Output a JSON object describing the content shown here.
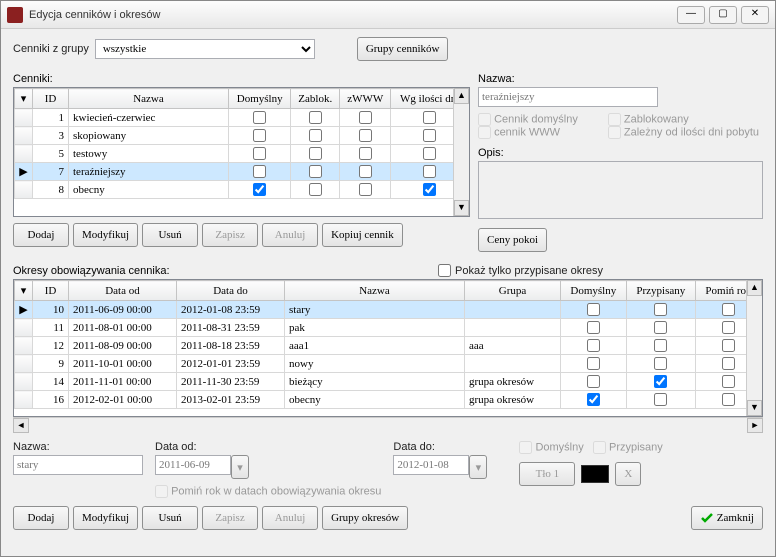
{
  "window": {
    "title": "Edycja cenników i okresów"
  },
  "topbar": {
    "group_label": "Cenniki z grupy",
    "group_selected": "wszystkie",
    "groups_btn": "Grupy cenników"
  },
  "cenniki": {
    "label": "Cenniki:",
    "columns": {
      "id": "ID",
      "nazwa": "Nazwa",
      "domyslny": "Domyślny",
      "zablok": "Zablok.",
      "zwww": "zWWW",
      "wgdni": "Wg ilości dni"
    },
    "rows": [
      {
        "id": 1,
        "nazwa": "kwiecień-czerwiec",
        "dom": false,
        "zab": false,
        "zw": false,
        "wg": false,
        "sel": false
      },
      {
        "id": 3,
        "nazwa": "skopiowany",
        "dom": false,
        "zab": false,
        "zw": false,
        "wg": false,
        "sel": false
      },
      {
        "id": 5,
        "nazwa": "testowy",
        "dom": false,
        "zab": false,
        "zw": false,
        "wg": false,
        "sel": false
      },
      {
        "id": 7,
        "nazwa": "teraźniejszy",
        "dom": false,
        "zab": false,
        "zw": false,
        "wg": false,
        "sel": true
      },
      {
        "id": 8,
        "nazwa": "obecny",
        "dom": true,
        "zab": false,
        "zw": false,
        "wg": true,
        "sel": false
      }
    ],
    "buttons": {
      "dodaj": "Dodaj",
      "modyfikuj": "Modyfikuj",
      "usun": "Usuń",
      "zapisz": "Zapisz",
      "anuluj": "Anuluj",
      "kopiuj": "Kopiuj cennik"
    }
  },
  "detail": {
    "nazwa_label": "Nazwa:",
    "nazwa_value": "teraźniejszy",
    "cb_domyslny": "Cennik domyślny",
    "cb_www": "cennik WWW",
    "cb_zablok": "Zablokowany",
    "cb_zalezny": "Zależny od ilości dni pobytu",
    "opis_label": "Opis:",
    "ceny_btn": "Ceny pokoi"
  },
  "okresy": {
    "label": "Okresy obowiązywania cennika:",
    "filter_label": "Pokaż tylko przypisane okresy",
    "columns": {
      "id": "ID",
      "dataod": "Data od",
      "datado": "Data do",
      "nazwa": "Nazwa",
      "grupa": "Grupa",
      "domyslny": "Domyślny",
      "przypisany": "Przypisany",
      "pomin": "Pomiń rok"
    },
    "rows": [
      {
        "id": 10,
        "od": "2011-06-09 00:00",
        "do": "2012-01-08 23:59",
        "naz": "stary",
        "gr": "",
        "dom": false,
        "prz": false,
        "pom": false,
        "sel": true
      },
      {
        "id": 11,
        "od": "2011-08-01 00:00",
        "do": "2011-08-31 23:59",
        "naz": "pak",
        "gr": "",
        "dom": false,
        "prz": false,
        "pom": false,
        "sel": false
      },
      {
        "id": 12,
        "od": "2011-08-09 00:00",
        "do": "2011-08-18 23:59",
        "naz": "aaa1",
        "gr": "aaa",
        "dom": false,
        "prz": false,
        "pom": false,
        "sel": false
      },
      {
        "id": 9,
        "od": "2011-10-01 00:00",
        "do": "2012-01-01 23:59",
        "naz": "nowy",
        "gr": "",
        "dom": false,
        "prz": false,
        "pom": false,
        "sel": false
      },
      {
        "id": 14,
        "od": "2011-11-01 00:00",
        "do": "2011-11-30 23:59",
        "naz": "bieżący",
        "gr": "grupa okresów",
        "dom": false,
        "prz": true,
        "pom": false,
        "sel": false
      },
      {
        "id": 16,
        "od": "2012-02-01 00:00",
        "do": "2013-02-01 23:59",
        "naz": "obecny",
        "gr": "grupa okresów",
        "dom": true,
        "prz": false,
        "pom": false,
        "sel": false
      }
    ]
  },
  "okres_form": {
    "nazwa_label": "Nazwa:",
    "nazwa_value": "stary",
    "od_label": "Data od:",
    "od_value": "2011-06-09",
    "do_label": "Data do:",
    "do_value": "2012-01-08",
    "cb_domyslny": "Domyślny",
    "cb_przypisany": "Przypisany",
    "cb_pomin": "Pomiń rok w datach obowiązywania okresu",
    "tlo_btn": "Tło 1",
    "x_btn": "X",
    "buttons": {
      "dodaj": "Dodaj",
      "modyfikuj": "Modyfikuj",
      "usun": "Usuń",
      "zapisz": "Zapisz",
      "anuluj": "Anuluj",
      "grupy": "Grupy okresów"
    },
    "zamknij": "Zamknij"
  }
}
